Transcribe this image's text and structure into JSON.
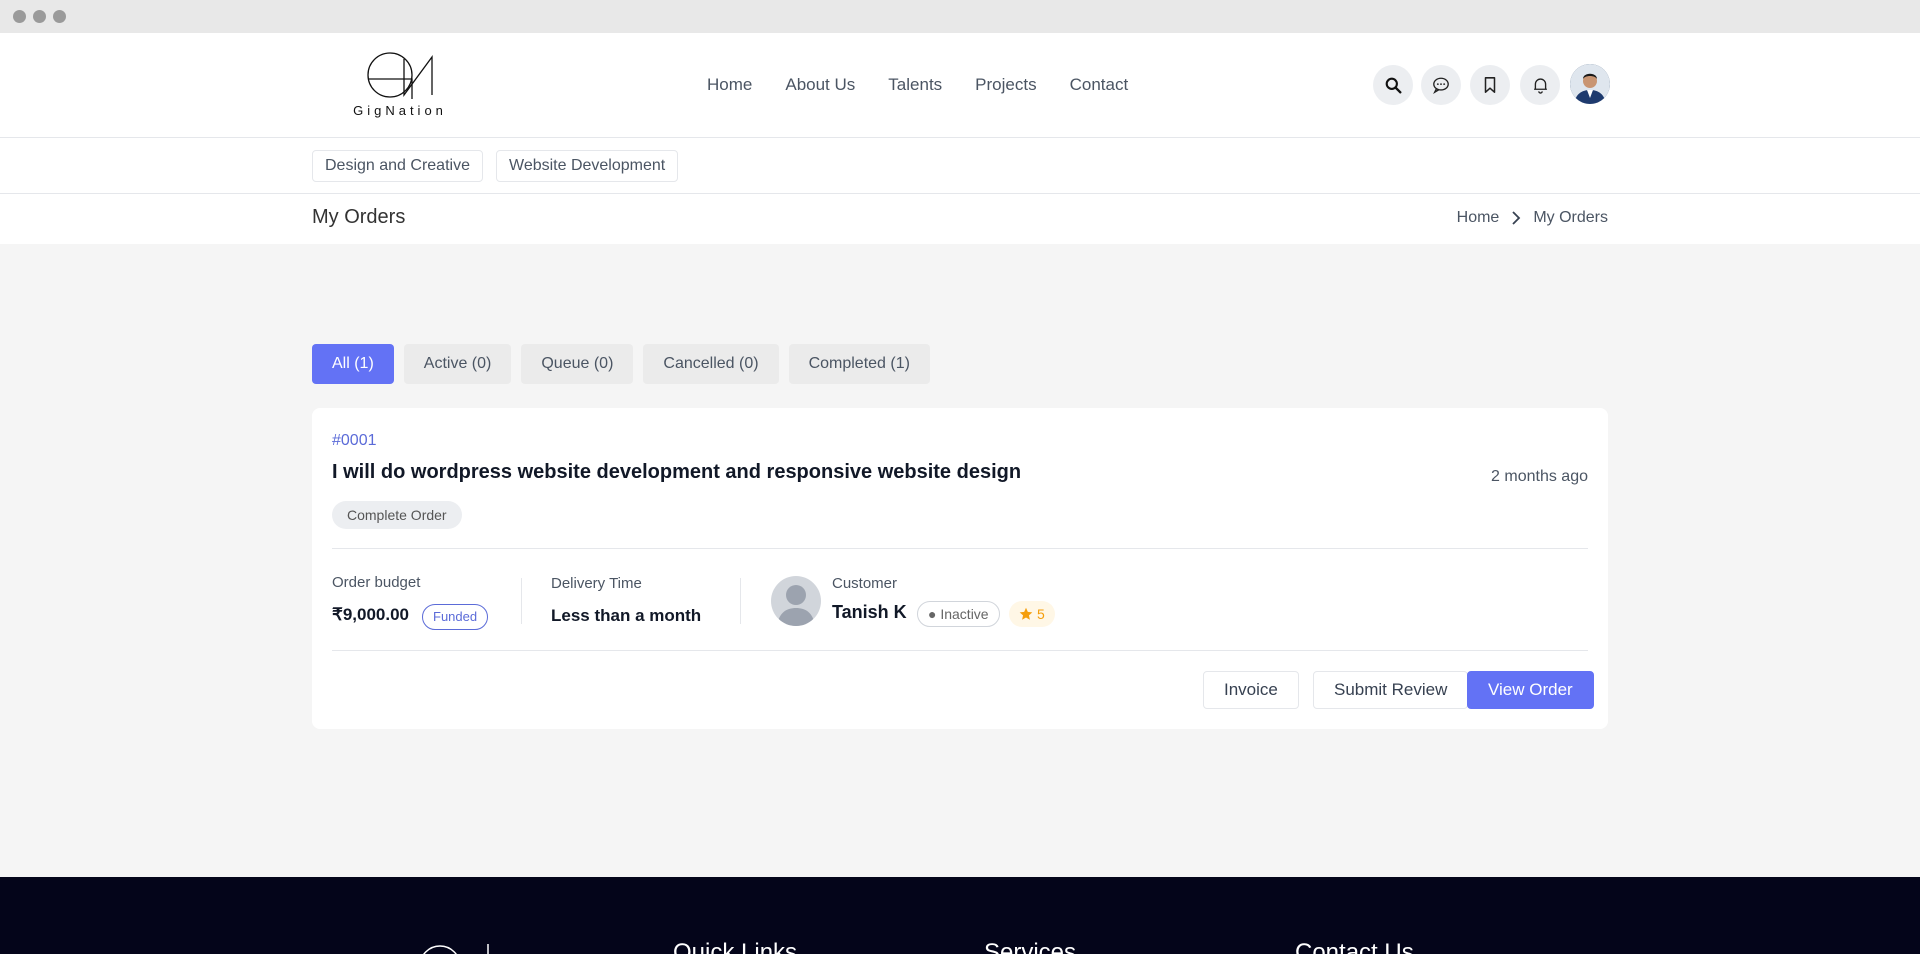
{
  "brand": {
    "logo_text": "GigNation"
  },
  "nav": {
    "items": [
      "Home",
      "About Us",
      "Talents",
      "Projects",
      "Contact"
    ]
  },
  "header_icons": [
    "search-icon",
    "chat-icon",
    "bookmark-icon",
    "bell-icon"
  ],
  "categories": [
    "Design and Creative",
    "Website Development"
  ],
  "page": {
    "title": "My Orders"
  },
  "breadcrumb": {
    "home": "Home",
    "current": "My Orders"
  },
  "tabs": [
    {
      "label": "All (1)",
      "active": true
    },
    {
      "label": "Active (0)",
      "active": false
    },
    {
      "label": "Queue (0)",
      "active": false
    },
    {
      "label": "Cancelled (0)",
      "active": false
    },
    {
      "label": "Completed (1)",
      "active": false
    }
  ],
  "order": {
    "id": "#0001",
    "title": "I will do wordpress website development and responsive website design",
    "time": "2 months ago",
    "status": "Complete Order",
    "budget_label": "Order budget",
    "budget_value": "₹9,000.00",
    "funded_label": "Funded",
    "delivery_label": "Delivery Time",
    "delivery_value": "Less than a month",
    "customer_label": "Customer",
    "customer_name": "Tanish K",
    "customer_status": "● Inactive",
    "rating": "5",
    "buttons": {
      "invoice": "Invoice",
      "review": "Submit Review",
      "view": "View Order"
    }
  },
  "footer": {
    "headings": [
      "Quick Links",
      "Services",
      "Contact Us"
    ]
  },
  "colors": {
    "accent": "#6372f5",
    "link": "#5b6bd8",
    "footer_bg": "#04051a"
  }
}
